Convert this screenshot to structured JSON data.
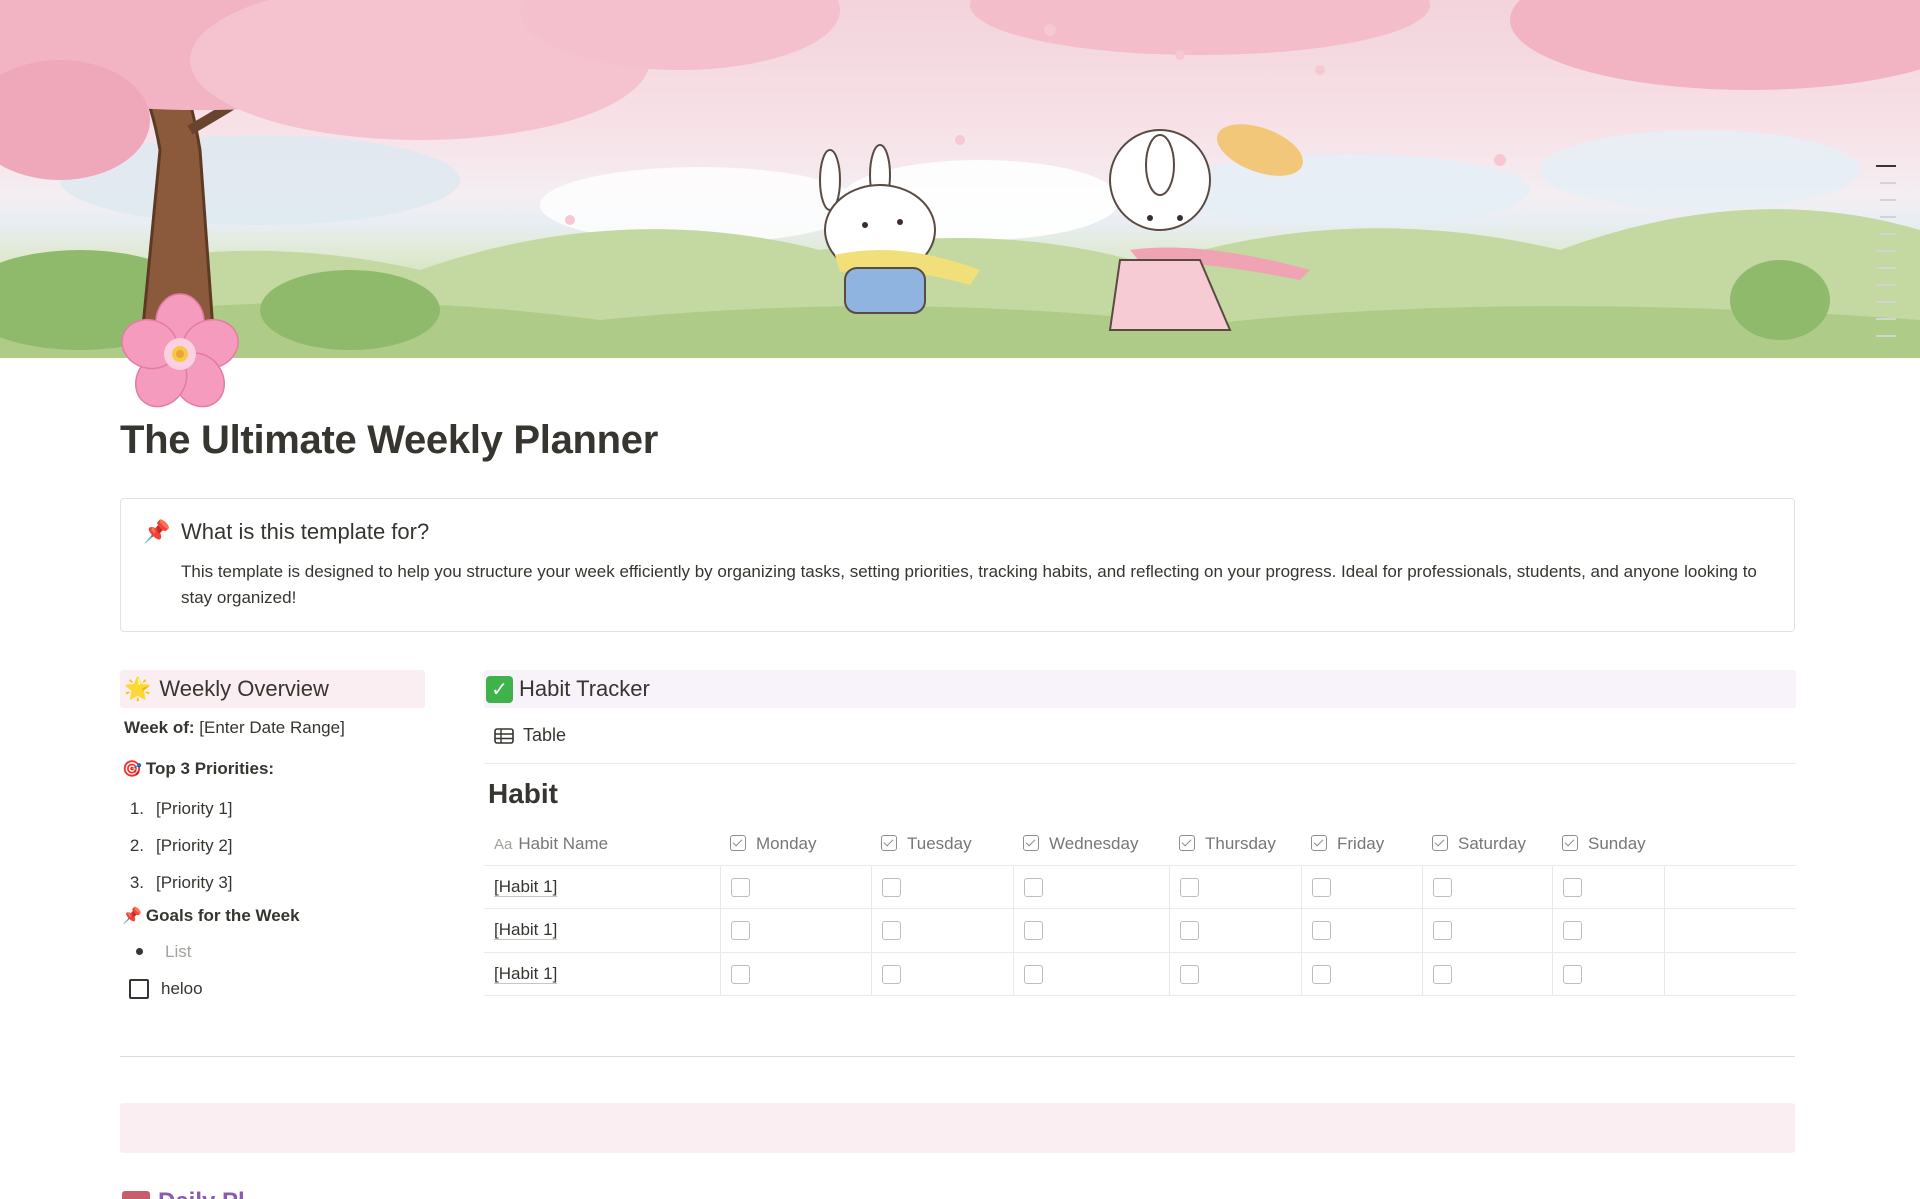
{
  "page": {
    "title": "The Ultimate Weekly Planner",
    "icon": "cherry-blossom-icon"
  },
  "callout": {
    "icon": "📌",
    "title": "What is this template for?",
    "body": "This template is designed to help you structure your week efficiently by organizing tasks, setting priorities, tracking habits, and reflecting on your progress. Ideal for professionals, students, and anyone looking to stay organized!"
  },
  "overview": {
    "icon": "🌟",
    "heading": "Weekly Overview",
    "week_of_label": "Week of:",
    "week_of_value": " [Enter Date Range]",
    "priorities_icon": "🎯",
    "priorities_heading": "Top 3 Priorities:",
    "priorities": [
      {
        "num": "1.",
        "text": "[Priority 1]"
      },
      {
        "num": "2.",
        "text": "[Priority 2]"
      },
      {
        "num": "3.",
        "text": "[Priority 3]"
      }
    ],
    "goals_icon": "📌",
    "goals_heading": "Goals for the Week",
    "goals_placeholder": "List",
    "todo_text": "heloo"
  },
  "habit_tracker": {
    "heading": "Habit Tracker",
    "view_tab": "Table",
    "db_title": "Habit",
    "name_col_icon": "Aa",
    "columns": [
      "Habit Name",
      "Monday",
      "Tuesday",
      "Wednesday",
      "Thursday",
      "Friday",
      "Saturday",
      "Sunday"
    ],
    "rows": [
      {
        "name": "[Habit 1]",
        "checks": [
          false,
          false,
          false,
          false,
          false,
          false,
          false
        ]
      },
      {
        "name": "[Habit 1]",
        "checks": [
          false,
          false,
          false,
          false,
          false,
          false,
          false
        ]
      },
      {
        "name": "[Habit 1]",
        "checks": [
          false,
          false,
          false,
          false,
          false,
          false,
          false
        ]
      }
    ]
  },
  "next_section": {
    "heading": "Daily Pl"
  },
  "colors": {
    "overview_bg": "#fbeef3",
    "habit_bg": "#f8f2fa",
    "text": "#37352f",
    "muted": "#787774"
  }
}
